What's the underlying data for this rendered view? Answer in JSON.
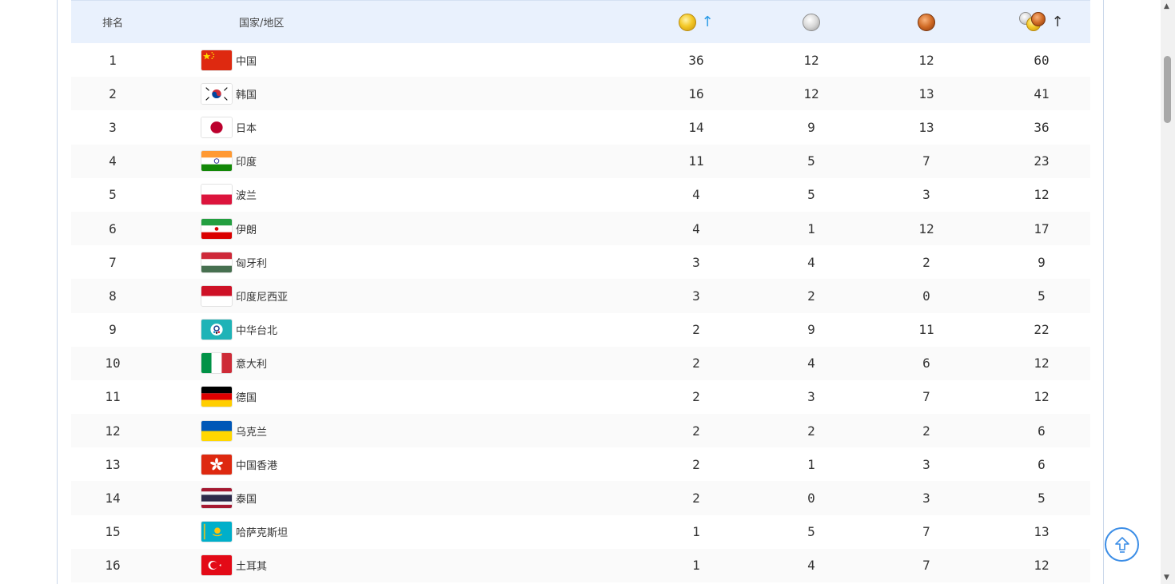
{
  "header": {
    "rank_label": "排名",
    "country_label": "国家/地区",
    "gold_icon": "gold-medal-icon",
    "silver_icon": "silver-medal-icon",
    "bronze_icon": "bronze-medal-icon",
    "total_icon": "medal-stack-icon",
    "sort_arrow": "↑"
  },
  "colors": {
    "header_bg": "#e9f1fd",
    "accent_blue": "#2c9be6",
    "back_to_top": "#3b8de6"
  },
  "rows": [
    {
      "rank": "1",
      "country": "中国",
      "flag": "cn",
      "gold": "36",
      "silver": "12",
      "bronze": "12",
      "total": "60"
    },
    {
      "rank": "2",
      "country": "韩国",
      "flag": "kr",
      "gold": "16",
      "silver": "12",
      "bronze": "13",
      "total": "41"
    },
    {
      "rank": "3",
      "country": "日本",
      "flag": "jp",
      "gold": "14",
      "silver": "9",
      "bronze": "13",
      "total": "36"
    },
    {
      "rank": "4",
      "country": "印度",
      "flag": "in",
      "gold": "11",
      "silver": "5",
      "bronze": "7",
      "total": "23"
    },
    {
      "rank": "5",
      "country": "波兰",
      "flag": "pl",
      "gold": "4",
      "silver": "5",
      "bronze": "3",
      "total": "12"
    },
    {
      "rank": "6",
      "country": "伊朗",
      "flag": "ir",
      "gold": "4",
      "silver": "1",
      "bronze": "12",
      "total": "17"
    },
    {
      "rank": "7",
      "country": "匈牙利",
      "flag": "hu",
      "gold": "3",
      "silver": "4",
      "bronze": "2",
      "total": "9"
    },
    {
      "rank": "8",
      "country": "印度尼西亚",
      "flag": "id",
      "gold": "3",
      "silver": "2",
      "bronze": "0",
      "total": "5"
    },
    {
      "rank": "9",
      "country": "中华台北",
      "flag": "tpe",
      "gold": "2",
      "silver": "9",
      "bronze": "11",
      "total": "22"
    },
    {
      "rank": "10",
      "country": "意大利",
      "flag": "it",
      "gold": "2",
      "silver": "4",
      "bronze": "6",
      "total": "12"
    },
    {
      "rank": "11",
      "country": "德国",
      "flag": "de",
      "gold": "2",
      "silver": "3",
      "bronze": "7",
      "total": "12"
    },
    {
      "rank": "12",
      "country": "乌克兰",
      "flag": "ua",
      "gold": "2",
      "silver": "2",
      "bronze": "2",
      "total": "6"
    },
    {
      "rank": "13",
      "country": "中国香港",
      "flag": "hk",
      "gold": "2",
      "silver": "1",
      "bronze": "3",
      "total": "6"
    },
    {
      "rank": "14",
      "country": "泰国",
      "flag": "th",
      "gold": "2",
      "silver": "0",
      "bronze": "3",
      "total": "5"
    },
    {
      "rank": "15",
      "country": "哈萨克斯坦",
      "flag": "kz",
      "gold": "1",
      "silver": "5",
      "bronze": "7",
      "total": "13"
    },
    {
      "rank": "16",
      "country": "土耳其",
      "flag": "tr",
      "gold": "1",
      "silver": "4",
      "bronze": "7",
      "total": "12"
    }
  ]
}
